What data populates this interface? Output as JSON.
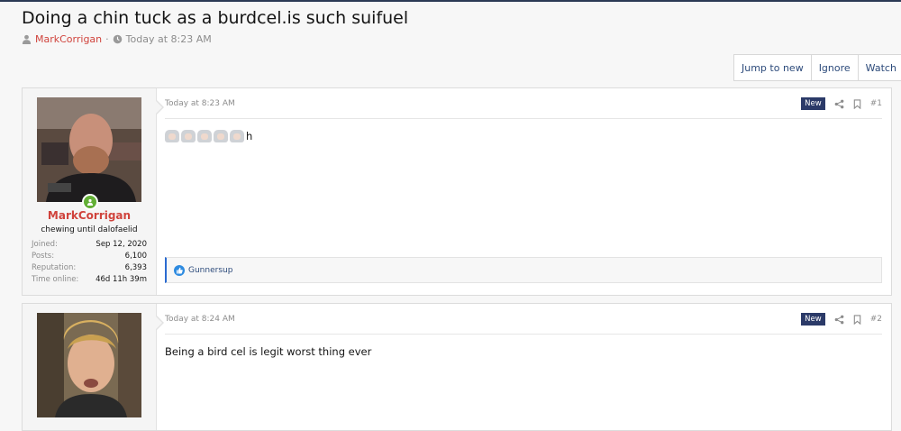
{
  "thread": {
    "title": "Doing a chin tuck as a burdcel.is such suifuel",
    "author": "MarkCorrigan",
    "separator": "·",
    "time": "Today at 8:23 AM"
  },
  "actions": {
    "jump": "Jump to new",
    "ignore": "Ignore",
    "watch": "Watch"
  },
  "posts": [
    {
      "username": "MarkCorrigan",
      "user_title": "chewing until dalofaelid",
      "stats": [
        {
          "label": "Joined:",
          "value": "Sep 12, 2020"
        },
        {
          "label": "Posts:",
          "value": "6,100"
        },
        {
          "label": "Reputation:",
          "value": "6,393"
        },
        {
          "label": "Time online:",
          "value": "46d 11h 39m"
        }
      ],
      "timestamp": "Today at 8:23 AM",
      "badge": "New",
      "number": "#1",
      "body_suffix": "h",
      "reaction_user": "Gunnersup"
    },
    {
      "timestamp": "Today at 8:24 AM",
      "badge": "New",
      "number": "#2",
      "body": "Being a bird cel is legit worst thing ever"
    }
  ]
}
